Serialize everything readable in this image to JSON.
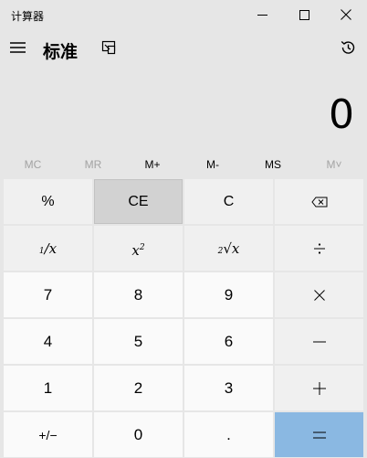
{
  "window": {
    "title": "计算器"
  },
  "header": {
    "mode": "标准"
  },
  "display": {
    "value": "0"
  },
  "memory": {
    "mc": "MC",
    "mr": "MR",
    "m_plus": "M+",
    "m_minus": "M-",
    "ms": "MS",
    "m_list": "M˅"
  },
  "keys": {
    "percent": "%",
    "ce": "CE",
    "c": "C",
    "seven": "7",
    "eight": "8",
    "nine": "9",
    "four": "4",
    "five": "5",
    "six": "6",
    "one": "1",
    "two": "2",
    "three": "3",
    "zero": "0",
    "decimal": ".",
    "negate": "+/−"
  },
  "colors": {
    "background": "#e6e6e6",
    "key": "#f0f0f0",
    "number_key": "#fafafa",
    "equals_key": "#8ab8e2",
    "disabled_text": "#a3a3a3"
  }
}
